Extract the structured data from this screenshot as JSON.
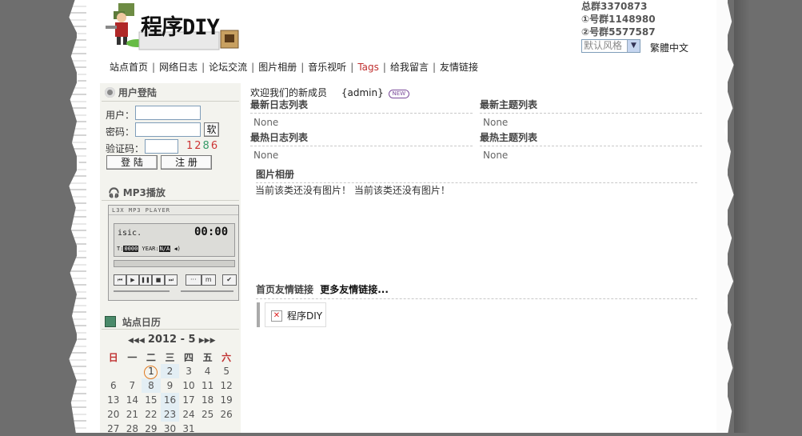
{
  "header": {
    "logo_text": "程序DIY",
    "groups": [
      "总群3370873",
      "①号群1148980",
      "②号群5577587"
    ],
    "style_select_value": "默认风格",
    "trad_simp_label": "繁體中文"
  },
  "nav": {
    "items": [
      "站点首页",
      "网络日志",
      "论坛交流",
      "图片相册",
      "音乐视听",
      "Tags",
      "给我留言",
      "友情链接"
    ]
  },
  "login": {
    "title": "用户登陆",
    "user_label": "用户：",
    "password_label": "密码：",
    "soft_kb_label": "软",
    "captcha_label": "验证码：",
    "captcha_code": "1286",
    "login_button": "登 陆",
    "register_button": "注 册"
  },
  "mp3": {
    "title": "MP3播放",
    "brand": "L3X MP3 PLAYER",
    "track": "isic.",
    "time": "00:00",
    "t_label": "T:",
    "t_value": "0000",
    "year_label": "YEAR:",
    "year_value": "N/A"
  },
  "calendar": {
    "title": "站点日历",
    "month": "2012 - 5",
    "weekdays": [
      "日",
      "一",
      "二",
      "三",
      "四",
      "五",
      "六"
    ],
    "rows": [
      [
        "",
        "",
        "1",
        "2",
        "3",
        "4",
        "5"
      ],
      [
        "6",
        "7",
        "8",
        "9",
        "10",
        "11",
        "12"
      ],
      [
        "13",
        "14",
        "15",
        "16",
        "17",
        "18",
        "19"
      ],
      [
        "20",
        "21",
        "22",
        "23",
        "24",
        "25",
        "26"
      ],
      [
        "27",
        "28",
        "29",
        "30",
        "31",
        "",
        ""
      ]
    ]
  },
  "main": {
    "welcome": "欢迎我们的新成员",
    "new_member": "{admin}",
    "new_badge": "NEW",
    "latest_logs_title": "最新日志列表",
    "latest_topics_title": "最新主题列表",
    "latest_logs_value": "None",
    "latest_topics_value": "None",
    "hot_logs_title": "最热日志列表",
    "hot_topics_title": "最热主题列表",
    "hot_logs_value": "None",
    "hot_topics_value": "None",
    "album_title": "图片相册",
    "album_empty": "当前该类还没有图片！ 当前该类还没有图片！",
    "links_title": "首页友情链接",
    "more_links": "更多友情链接...",
    "link_item": "程序DIY"
  },
  "colors": {
    "tags_red": "#c03030",
    "captcha_red": "#cc3333",
    "captcha_green": "#339966",
    "sunday_red": "#c03030"
  }
}
